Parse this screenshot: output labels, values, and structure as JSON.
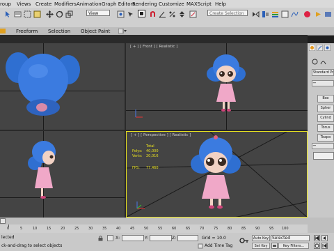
{
  "menu": [
    "roup",
    "Views",
    "Create",
    "Modifiers",
    "Animation",
    "Graph Editors",
    "Rendering",
    "Customize",
    "MAXScript",
    "Help"
  ],
  "toolbar": {
    "view_dropdown": "View",
    "selection_set_placeholder": "Create Selection Se"
  },
  "ribbon": {
    "tabs": [
      "Freeform",
      "Selection",
      "Object Paint"
    ]
  },
  "viewports": {
    "front_label": "[ + ] [ Front ] [ Realistic ]",
    "left_label": "",
    "perspective_label": "[ + ] [ Perspective ] [ Realistic ]"
  },
  "stats": {
    "total_label": "Total",
    "polys_label": "Polys:",
    "polys_value": "40,000",
    "verts_label": "Verts:",
    "verts_value": "20,016",
    "fps_label": "FPS:",
    "fps_value": "77.460"
  },
  "command_panel": {
    "category": "Standard Pri",
    "object_type_buttons": [
      "Box",
      "Spher",
      "Cylind",
      "Torus",
      "Teapo"
    ]
  },
  "timeline": {
    "ticks": [
      "0",
      "5",
      "10",
      "15",
      "20",
      "25",
      "30",
      "35",
      "40",
      "45",
      "50",
      "55",
      "60",
      "65",
      "70",
      "75",
      "80",
      "85",
      "90",
      "95",
      "100"
    ]
  },
  "status": {
    "selected_line": "lected",
    "prompt_line": "ck-and-drag to select objects",
    "x_label": "X:",
    "y_label": "Y:",
    "z_label": "Z:",
    "grid_text": "Grid = 10.0",
    "add_time_tag": "Add Time Tag",
    "auto_key": "Auto Key",
    "set_key": "Set Key",
    "key_mode_value": "Selected",
    "key_filters": "Key Filters..."
  },
  "colors": {
    "viewport_bg": "#444444",
    "active_border": "#e6e020",
    "stats_text": "#e8e020",
    "character_hair": "#2f6fd1",
    "character_dress": "#f0a8c8"
  }
}
